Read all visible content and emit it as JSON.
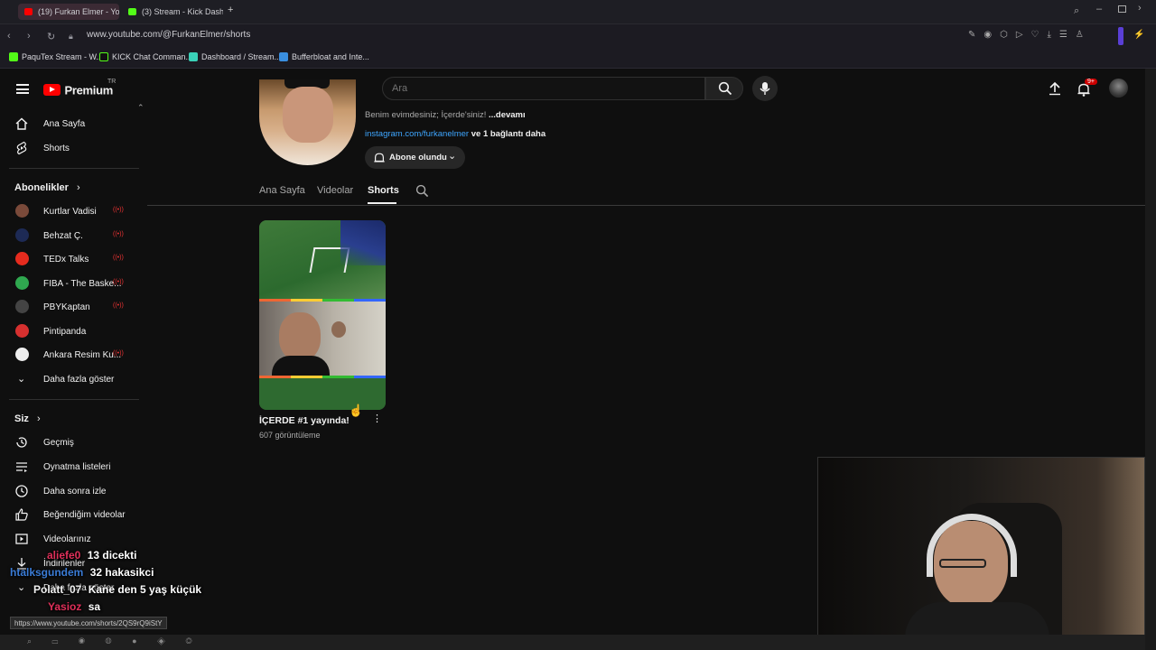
{
  "browser": {
    "tabs": [
      {
        "label": "(19) Furkan Elmer - YouTu",
        "active": true,
        "color": "#ff0000"
      },
      {
        "label": "(3) Stream - Kick Dashbo",
        "active": false,
        "color": "#53fc18"
      }
    ],
    "new_tab": "+",
    "url": "www.youtube.com/@FurkanElmer/shorts",
    "bookmarks": [
      {
        "label": "PaquTex Stream - W...",
        "color": "#53fc18"
      },
      {
        "label": "KICK Chat Comman...",
        "color": "#111111"
      },
      {
        "label": "Dashboard / Stream...",
        "color": "#3ad1b8"
      },
      {
        "label": "Bufferbloat and Inte...",
        "color": "#3a8fe0"
      }
    ]
  },
  "youtube": {
    "logo_text": "Premium",
    "region": "TR",
    "search_placeholder": "Ara",
    "notification_badge": "9+",
    "nav": [
      {
        "label": "Ana Sayfa",
        "icon": "home-icon"
      },
      {
        "label": "Shorts",
        "icon": "shorts-icon"
      }
    ],
    "subscriptions_title": "Abonelikler",
    "subscriptions": [
      {
        "label": "Kurtlar Vadisi",
        "color": "#7a4a3a"
      },
      {
        "label": "Behzat Ç.",
        "color": "#1d2a55"
      },
      {
        "label": "TEDx Talks",
        "color": "#e62b1e"
      },
      {
        "label": "FIBA - The Baske...",
        "color": "#2fa84f"
      },
      {
        "label": "PBYKaptan",
        "color": "#444444"
      },
      {
        "label": "Pintipanda",
        "color": "#d6302f"
      },
      {
        "label": "Ankara Resim Ku...",
        "color": "#eeeeee"
      }
    ],
    "show_more": "Daha fazla göster",
    "you_title": "Siz",
    "you_items": [
      {
        "label": "Geçmiş",
        "icon": "history-icon"
      },
      {
        "label": "Oynatma listeleri",
        "icon": "playlist-icon"
      },
      {
        "label": "Daha sonra izle",
        "icon": "clock-icon"
      },
      {
        "label": "Beğendiğim videolar",
        "icon": "thumbs-up-icon"
      },
      {
        "label": "Videolarınız",
        "icon": "video-icon"
      },
      {
        "label": "İndirilenler",
        "icon": "download-icon"
      },
      {
        "label": "Daha fazla göster",
        "icon": "chevron-down-icon"
      }
    ],
    "channel": {
      "description": "Benim evimdesiniz; İçerde'siniz!",
      "more": "...devamı",
      "link": "instagram.com/furkanelmer",
      "link_more": "ve 1 bağlantı daha",
      "subscribe_label": "Abone olundu"
    },
    "tabs": [
      "Ana Sayfa",
      "Videolar",
      "Shorts"
    ],
    "active_tab": "Shorts",
    "shorts": [
      {
        "title": "İÇERDE #1 yayında!",
        "views": "607 görüntüleme"
      }
    ]
  },
  "chat": [
    {
      "user": "aliefe0",
      "message": "13 dicekti",
      "color": "#e0305a"
    },
    {
      "user": "htalksgundem",
      "message": "32 hakasikci",
      "color": "#3a7bd5"
    },
    {
      "user": "Polatt_07",
      "message": "Kane den 5 yaş küçük",
      "color": "#f1f1f1"
    },
    {
      "user": "Yasioz",
      "message": "sa",
      "color": "#e0305a"
    }
  ],
  "status_url": "https://www.youtube.com/shorts/2QS9rQ9iStY"
}
